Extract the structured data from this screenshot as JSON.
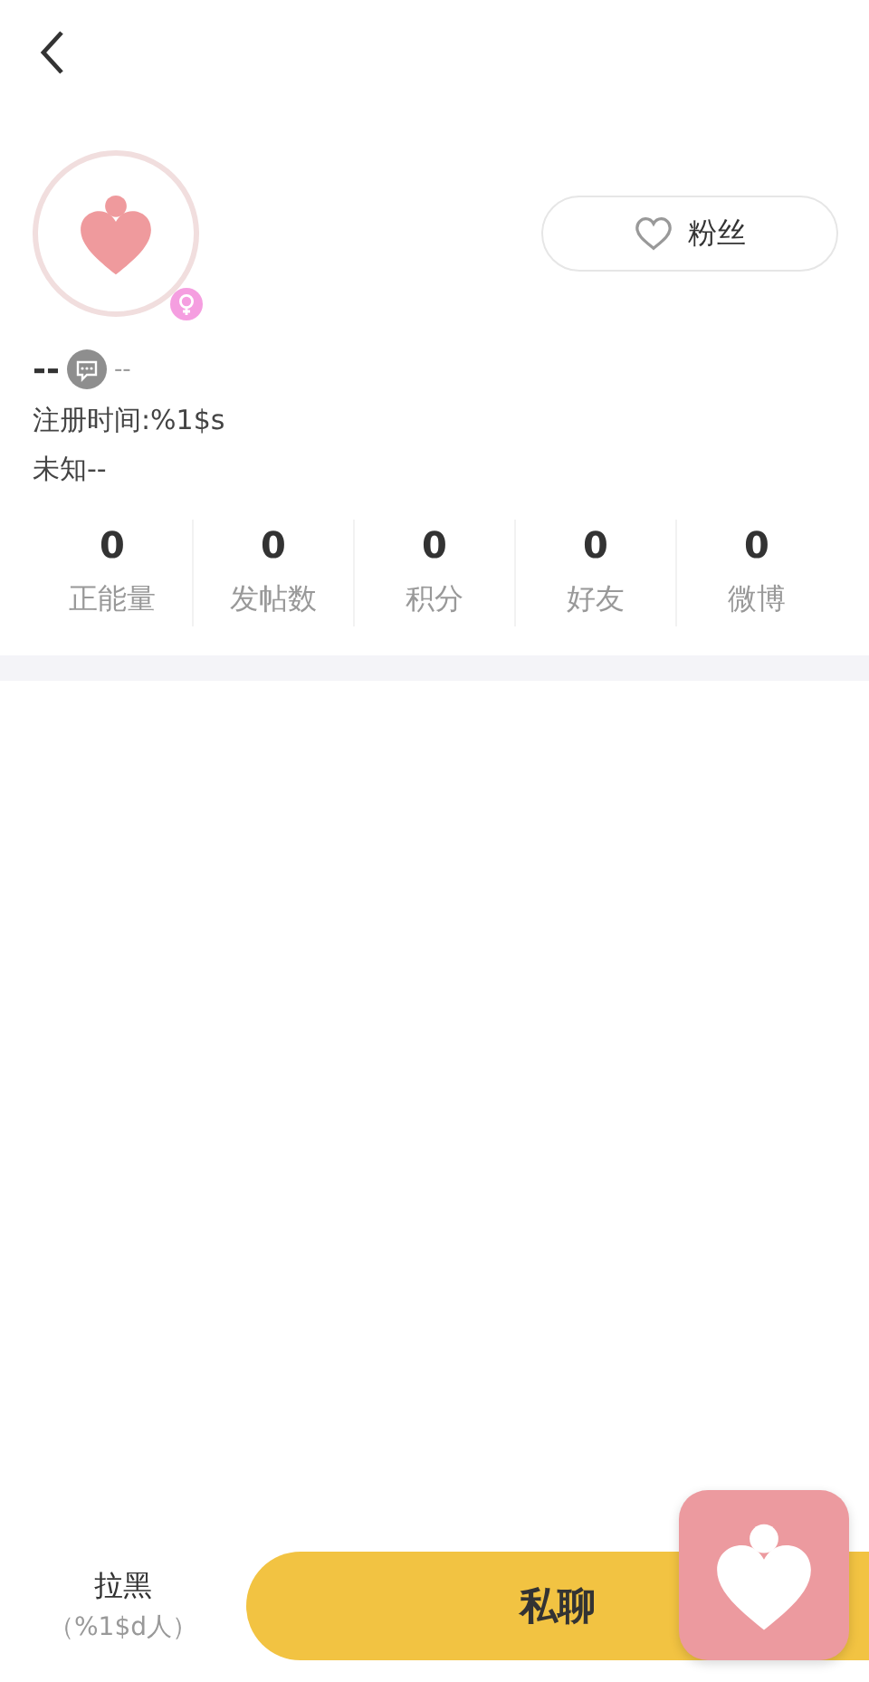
{
  "profile": {
    "name": "--",
    "badge_text": "--",
    "registered": "注册时间:%1$s",
    "location": "未知--"
  },
  "fans_button": {
    "label": "粉丝"
  },
  "stats": [
    {
      "value": "0",
      "label": "正能量"
    },
    {
      "value": "0",
      "label": "发帖数"
    },
    {
      "value": "0",
      "label": "积分"
    },
    {
      "value": "0",
      "label": "好友"
    },
    {
      "value": "0",
      "label": "微博"
    }
  ],
  "bottom_bar": {
    "block_label": "拉黑",
    "block_count": "（%1$d人）",
    "chat_button": "私聊"
  }
}
